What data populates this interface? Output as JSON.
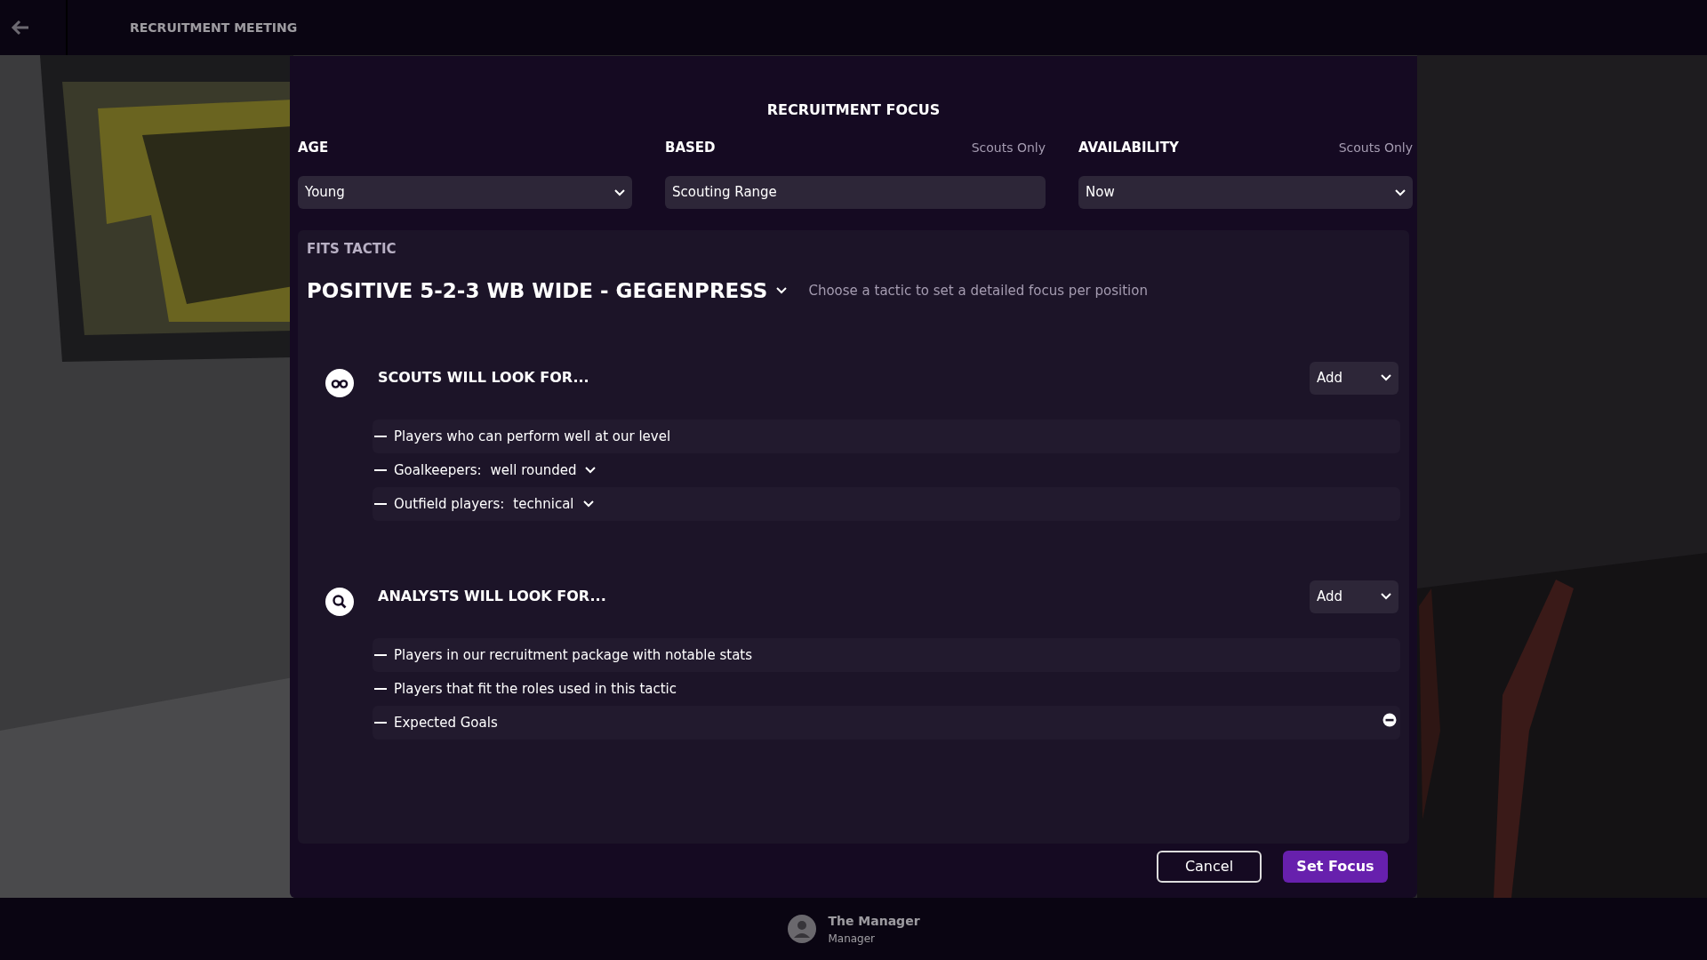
{
  "top_bar": {
    "title": "RECRUITMENT MEETING"
  },
  "dialog": {
    "title": "RECRUITMENT FOCUS",
    "filters": [
      {
        "label": "AGE",
        "value": "Young"
      },
      {
        "label": "BASED",
        "note": "Scouts Only",
        "value": "Scouting Range"
      },
      {
        "label": "AVAILABILITY",
        "note": "Scouts Only",
        "value": "Now"
      }
    ],
    "tactic": {
      "label": "FITS TACTIC",
      "name": "POSITIVE 5-2-3 WB WIDE - GEGENPRESS",
      "hint": "Choose a tactic to set a detailed focus per position"
    },
    "sections": [
      {
        "kind": "scouts",
        "title": "SCOUTS WILL LOOK FOR...",
        "add_button": "Add",
        "items": [
          {
            "kind": "text",
            "text": "Players who can perform well at our level",
            "removable": false
          },
          {
            "kind": "choice",
            "text": "Goalkeepers:",
            "value": "well rounded",
            "removable": false
          },
          {
            "kind": "choice",
            "text": "Outfield players:",
            "value": "technical",
            "removable": false
          }
        ]
      },
      {
        "kind": "analysts",
        "title": "ANALYSTS WILL LOOK FOR...",
        "add_button": "Add",
        "items": [
          {
            "kind": "text",
            "text": "Players in our recruitment package with notable stats",
            "removable": false
          },
          {
            "kind": "text",
            "text": "Players that fit the roles used in this tactic",
            "removable": false
          },
          {
            "kind": "text",
            "text": "Expected Goals",
            "removable": true
          }
        ]
      }
    ],
    "buttons": [
      {
        "kind": "secondary",
        "label": "Cancel"
      },
      {
        "kind": "primary",
        "label": "Set Focus"
      }
    ]
  },
  "bottom_bar": {
    "name": "The Manager",
    "role": "Manager"
  }
}
